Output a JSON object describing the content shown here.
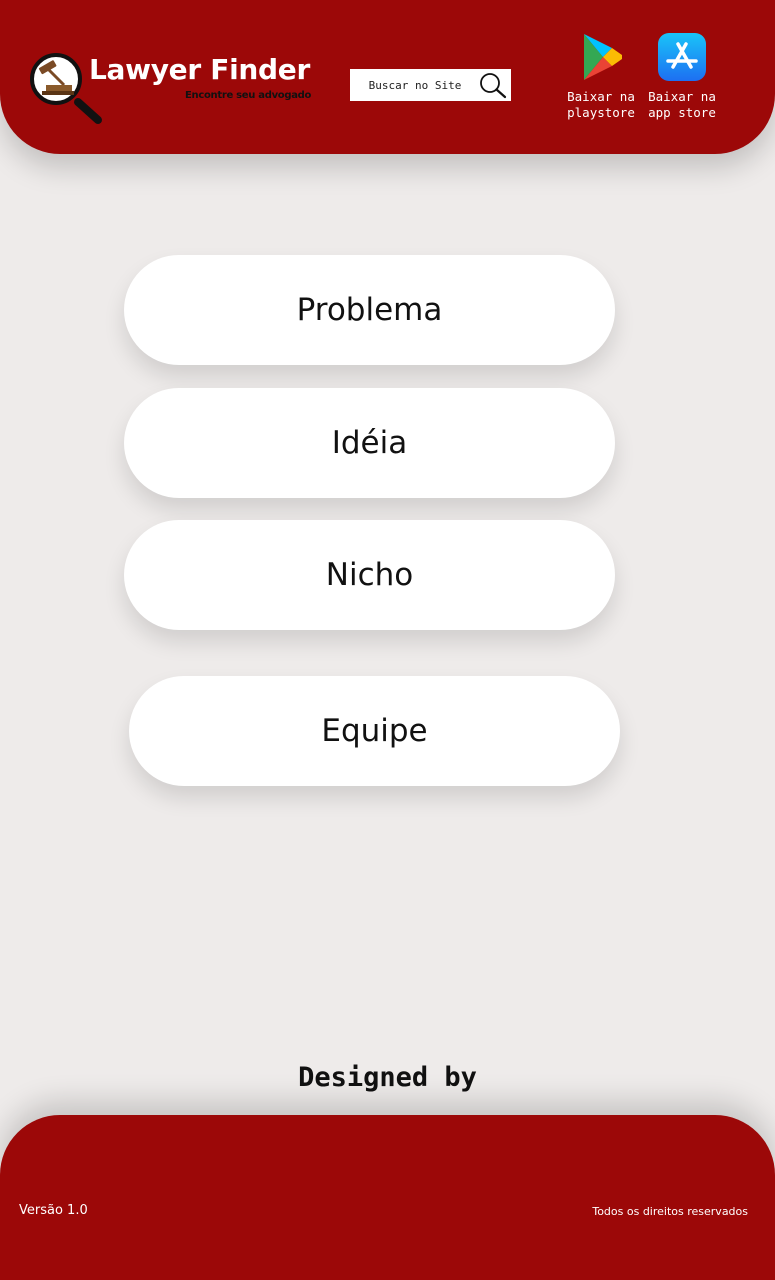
{
  "colors": {
    "brand_red": "#9c0808",
    "background": "#eeebea",
    "button_bg": "#ffffff",
    "text_dark": "#111111"
  },
  "header": {
    "logo": "magnifier-with-gavel-icon",
    "title": "Lawyer Finder",
    "tagline": "Encontre seu advogado",
    "search": {
      "placeholder": "Buscar no Site",
      "value": "",
      "icon": "search-icon"
    },
    "stores": [
      {
        "icon": "google-play-icon",
        "label": "Baixar na\nplaystore"
      },
      {
        "icon": "app-store-icon",
        "label": "Baixar na\napp store"
      }
    ]
  },
  "menu": {
    "items": [
      {
        "label": "Problema"
      },
      {
        "label": "Idéia"
      },
      {
        "label": "Nicho"
      },
      {
        "label": "Equipe"
      }
    ]
  },
  "designed_by": "Designed by",
  "footer": {
    "version": "Versão 1.0",
    "rights": "Todos os direitos reservados"
  }
}
